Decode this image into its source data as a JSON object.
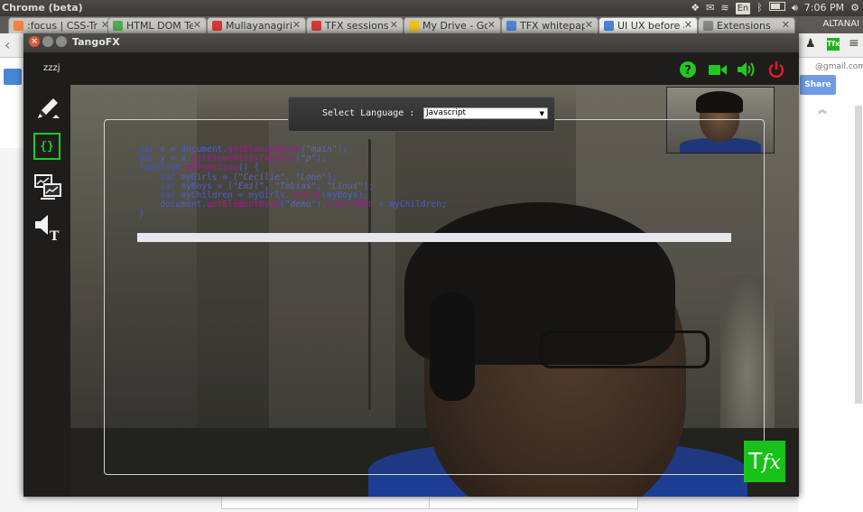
{
  "os": {
    "app_title": "Chrome (beta)",
    "language": "En",
    "time": "7:06 PM"
  },
  "tabs": [
    {
      "label": ":focus | CSS-Tr",
      "favicon_color": "#f4813f"
    },
    {
      "label": "HTML DOM Te",
      "favicon_color": "#4caf50"
    },
    {
      "label": "Mullayanagiri",
      "favicon_color": "#d63b2f"
    },
    {
      "label": "TFX sessions c",
      "favicon_color": "#d63b2f"
    },
    {
      "label": "My Drive - Goo",
      "favicon_color": "#f4c20d"
    },
    {
      "label": "TFX whitepap",
      "favicon_color": "#4a86d6"
    },
    {
      "label": "UI UX before a",
      "favicon_color": "#4a86d6",
      "active": true
    },
    {
      "label": "Extensions",
      "favicon_color": "#888888"
    }
  ],
  "profile_name": "ALTANAI",
  "chrome_page": {
    "email_fragment": "@gmail.com",
    "share_label": "Share"
  },
  "tangofx": {
    "window_title": "TangoFX",
    "username": "zzzj",
    "language_label": "Select Language :",
    "language_value": "Javascript",
    "logo_text": "T",
    "logo_fx": "fx",
    "accent_color": "#22c922",
    "power_color": "#e02020",
    "code": [
      "var x = document.getElementById(\"main\");",
      "var y = x.getElementsByTagName(\"p\");",
      "function myFunction() {",
      "    var myGirls = [\"Cecilie\", \"Lone\"];",
      "    var myBoys = [\"Emil\", \"Tobias\", \"Linus\"];",
      "    var myChildren = myGirls.concat(myBoys);",
      "    document.getElementById(\"demo\").innerHTML = myChildren;",
      "}"
    ]
  }
}
